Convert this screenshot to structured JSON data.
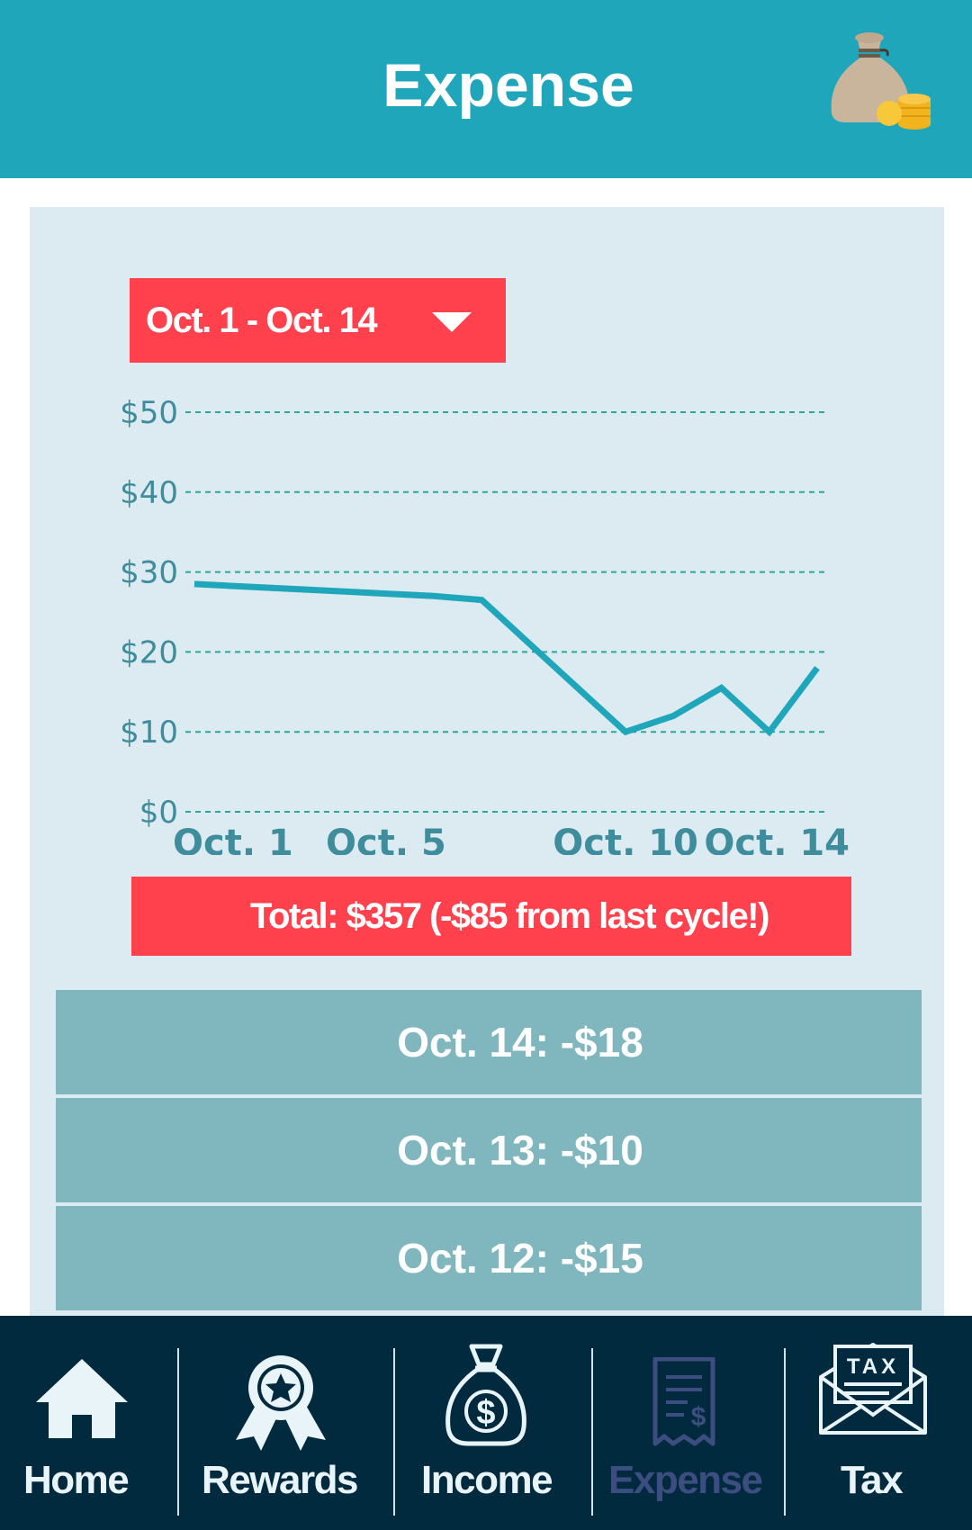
{
  "header": {
    "title": "Expense",
    "icon": "money-bag-icon"
  },
  "date_range": {
    "label": "Oct. 1 - Oct. 14"
  },
  "chart_data": {
    "type": "line",
    "x": [
      1,
      2,
      3,
      4,
      5,
      6,
      7,
      8,
      9,
      10,
      11,
      12,
      13,
      14
    ],
    "values": [
      28.5,
      28.2,
      27.9,
      27.6,
      27.3,
      27.0,
      26.5,
      21.0,
      15.5,
      10.0,
      12.0,
      15.5,
      10.0,
      18.0
    ],
    "x_tick_values": [
      1,
      5,
      10,
      14
    ],
    "x_tick_labels": [
      "Oct. 1",
      "Oct. 5",
      "Oct. 10",
      "Oct. 14"
    ],
    "y_tick_values": [
      0,
      10,
      20,
      30,
      40,
      50
    ],
    "y_tick_labels": [
      "$0",
      "$10",
      "$20",
      "$30",
      "$40",
      "$50"
    ],
    "ylim": [
      0,
      50
    ],
    "xlim": [
      1,
      14
    ],
    "grid": true,
    "line_color": "#1fa6bb",
    "grid_color": "#2aa89a",
    "title": "",
    "xlabel": "",
    "ylabel": ""
  },
  "summary": {
    "total": "Total: $357 (-$85 from last cycle!)"
  },
  "transactions": [
    {
      "label": "Oct. 14: -$18"
    },
    {
      "label": "Oct. 13: -$10"
    },
    {
      "label": "Oct. 12: -$15"
    }
  ],
  "nav": {
    "items": [
      {
        "label": "Home",
        "icon": "home-icon"
      },
      {
        "label": "Rewards",
        "icon": "rewards-badge-icon"
      },
      {
        "label": "Income",
        "icon": "money-bag-dollar-icon"
      },
      {
        "label": "Expense",
        "icon": "receipt-icon",
        "active": true
      },
      {
        "label": "Tax",
        "icon": "tax-envelope-icon"
      }
    ]
  },
  "colors": {
    "header": "#1fa6bb",
    "accent_red": "#ff404d",
    "card_bg": "#dbebf1",
    "list_item": "#80b6bd",
    "nav_bg": "#022a3e",
    "nav_active": "#3c4e80"
  }
}
